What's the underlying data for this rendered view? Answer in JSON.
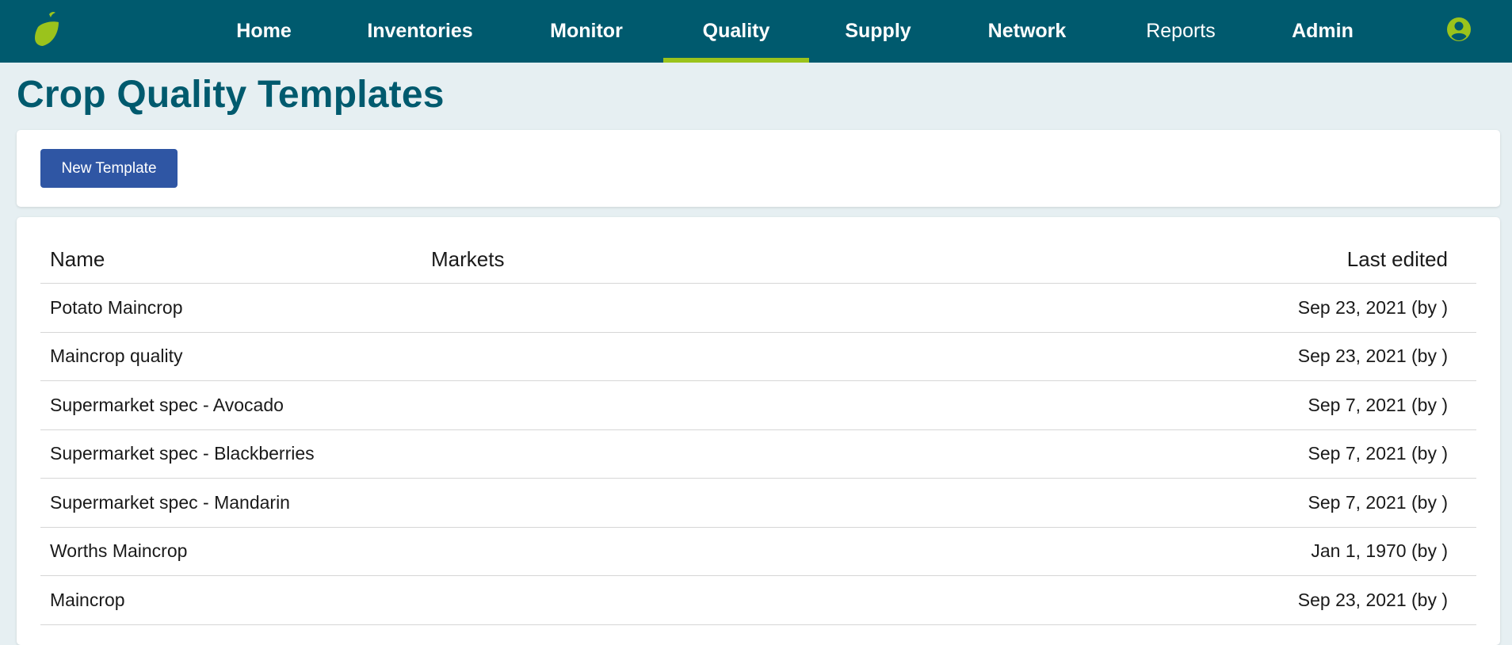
{
  "nav": {
    "logo_icon": "leaf-logo-icon",
    "items": [
      {
        "label": "Home"
      },
      {
        "label": "Inventories"
      },
      {
        "label": "Monitor"
      },
      {
        "label": "Quality"
      },
      {
        "label": "Supply"
      },
      {
        "label": "Network"
      },
      {
        "label": "Reports"
      },
      {
        "label": "Admin"
      }
    ],
    "active": "Quality",
    "user_icon": "user-circle-icon",
    "colors": {
      "bar": "#005a6e",
      "accent": "#9bc31c"
    }
  },
  "page": {
    "title": "Crop Quality Templates"
  },
  "actions": {
    "new_template_label": "New Template",
    "button_color": "#2f56a4"
  },
  "table": {
    "headers": {
      "name": "Name",
      "markets": "Markets",
      "last_edited": "Last edited"
    },
    "rows": [
      {
        "name": "Potato Maincrop",
        "markets": "",
        "last_edited": "Sep 23, 2021 (by )"
      },
      {
        "name": "Maincrop quality",
        "markets": "",
        "last_edited": "Sep 23, 2021 (by )"
      },
      {
        "name": "Supermarket spec - Avocado",
        "markets": "",
        "last_edited": "Sep 7, 2021 (by )"
      },
      {
        "name": "Supermarket spec - Blackberries",
        "markets": "",
        "last_edited": "Sep 7, 2021 (by )"
      },
      {
        "name": "Supermarket spec - Mandarin",
        "markets": "",
        "last_edited": "Sep 7, 2021 (by )"
      },
      {
        "name": "Worths Maincrop",
        "markets": "",
        "last_edited": "Jan 1, 1970 (by )"
      },
      {
        "name": "Maincrop",
        "markets": "",
        "last_edited": "Sep 23, 2021 (by )"
      }
    ]
  }
}
